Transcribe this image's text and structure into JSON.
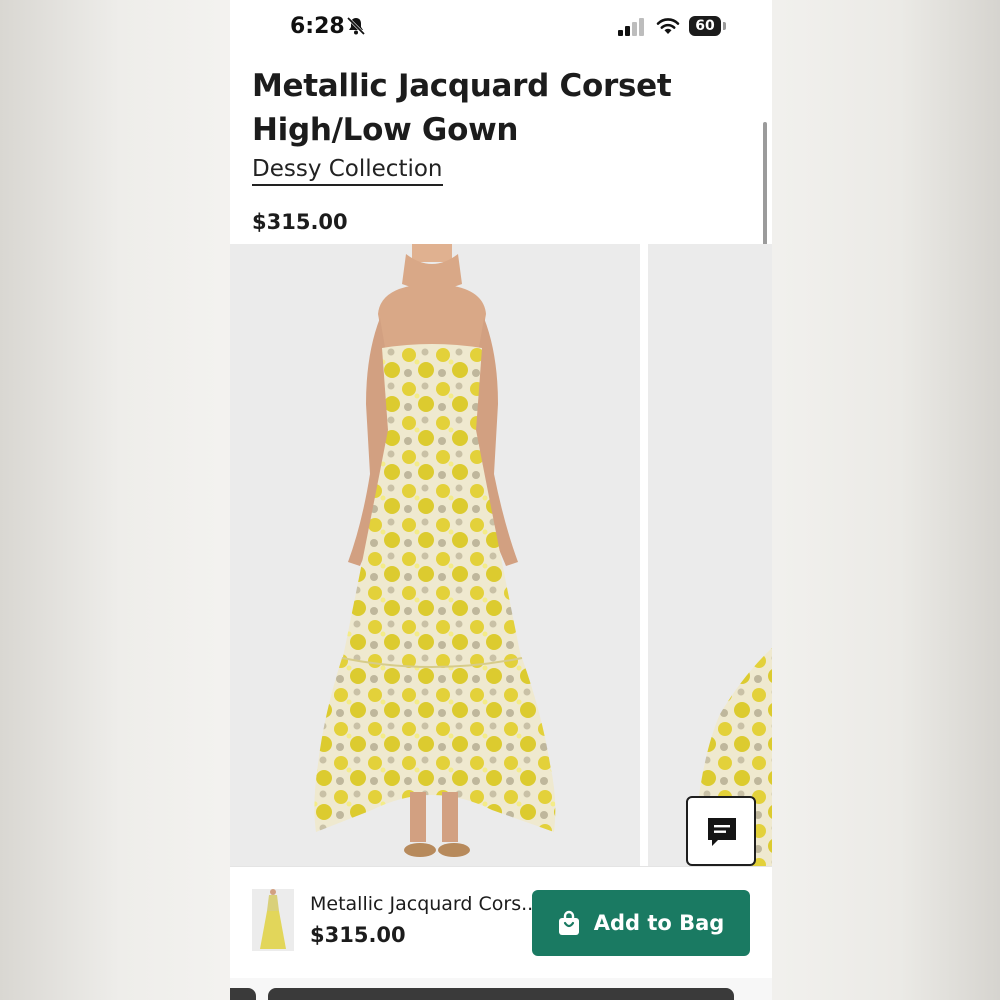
{
  "status_bar": {
    "time": "6:28",
    "battery": "60",
    "icons": [
      "bell-off-icon",
      "signal-icon",
      "wifi-icon",
      "battery-icon"
    ]
  },
  "product": {
    "title": "Metallic Jacquard Corset High/Low Gown",
    "brand": "Dessy Collection",
    "price": "$315.00"
  },
  "bottom_bar": {
    "name": "Metallic Jacquard Cors...",
    "price": "$315.00",
    "button_label": "Add to Bag"
  },
  "colors": {
    "add_to_bag": "#1a7a62",
    "gown_yellow": "#e3d13a",
    "gown_base": "#efe9cf"
  },
  "icons": {
    "chat": "chat-icon",
    "bag": "bag-icon"
  }
}
